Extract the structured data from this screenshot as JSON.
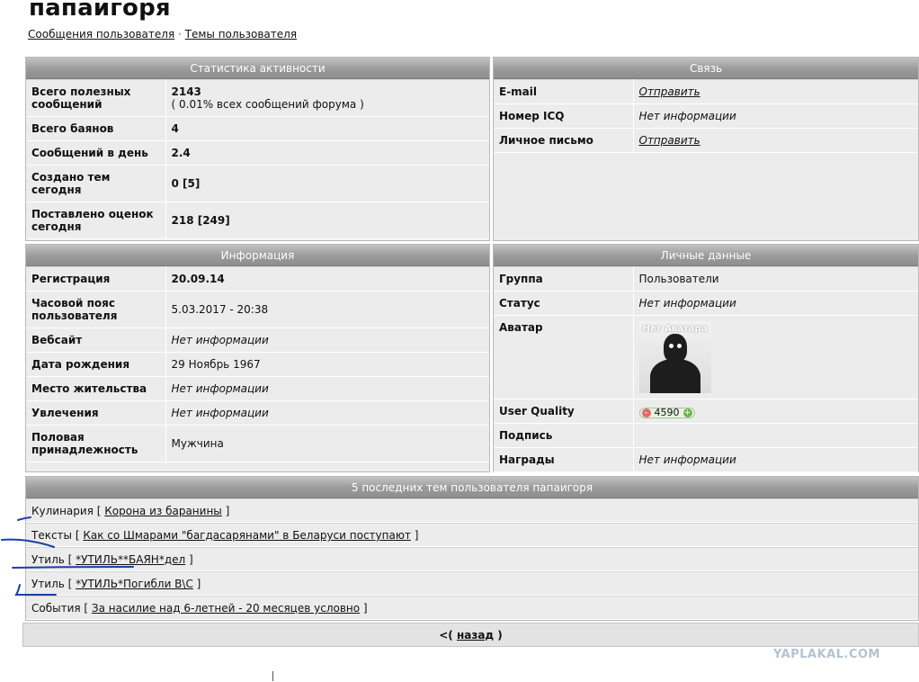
{
  "profile": {
    "username": "папаигоря",
    "links": [
      "Сообщения пользователя",
      "Темы пользователя"
    ],
    "separator": "·"
  },
  "activity": {
    "title": "Статистика активности",
    "rows": [
      {
        "label": "Всего полезных сообщений",
        "value": "2143",
        "sub": "( 0.01% всех сообщений форума )"
      },
      {
        "label": "Всего баянов",
        "value": "4"
      },
      {
        "label": "Сообщений в день",
        "value": "2.4"
      },
      {
        "label": "Создано тем сегодня",
        "value": "0 [5]"
      },
      {
        "label": "Поставлено оценок сегодня",
        "value": "218 [249]"
      }
    ]
  },
  "contact": {
    "title": "Связь",
    "rows": [
      {
        "label": "E-mail",
        "value": "Отправить"
      },
      {
        "label": "Номер ICQ",
        "value": "Нет информации"
      },
      {
        "label": "Личное письмо",
        "value": "Отправить"
      }
    ]
  },
  "info": {
    "title": "Информация",
    "rows": [
      {
        "label": "Регистрация",
        "value": "20.09.14"
      },
      {
        "label": "Часовой пояс пользователя",
        "value": "5.03.2017 - 20:38"
      },
      {
        "label": "Вебсайт",
        "value": "Нет информации"
      },
      {
        "label": "Дата рождения",
        "value": "29 Ноябрь 1967"
      },
      {
        "label": "Место жительства",
        "value": "Нет информации"
      },
      {
        "label": "Увлечения",
        "value": "Нет информации"
      },
      {
        "label": "Половая принадлежность",
        "value": "Мужчина"
      }
    ]
  },
  "personal": {
    "title": "Личные данные",
    "rows": [
      {
        "label": "Группа",
        "value": "Пользователи"
      },
      {
        "label": "Статус",
        "value": "Нет информации"
      },
      {
        "label": "Аватар",
        "value": "Нет Аватара"
      },
      {
        "label": "User Quality",
        "value": "4590"
      },
      {
        "label": "Подпись",
        "value": ""
      },
      {
        "label": "Награды",
        "value": "Нет информации"
      }
    ]
  },
  "topics": {
    "title": "5 последних тем пользователя папаигоря",
    "items": [
      {
        "section": "Кулинария",
        "title": "Корона из баранины"
      },
      {
        "section": "Тексты",
        "title": "Как со Шмарами \"багдасарянами\" в Беларуси поступают"
      },
      {
        "section": "Утиль",
        "title": "*УТИЛЬ**БАЯН*дел"
      },
      {
        "section": "Утиль",
        "title": "*УТИЛЬ*Погибли В\\С"
      },
      {
        "section": "События",
        "title": "За насилие над 6-летней - 20 месяцев условно"
      }
    ]
  },
  "nav": {
    "back_prefix": "<(",
    "back_label": "назад",
    "back_suffix": ")"
  },
  "watermark": "YAPLAKAL.COM",
  "colors": {
    "header_bg": "#9a9a9a",
    "panel_bg": "#ececec",
    "annotation": "#1a3fa8"
  }
}
